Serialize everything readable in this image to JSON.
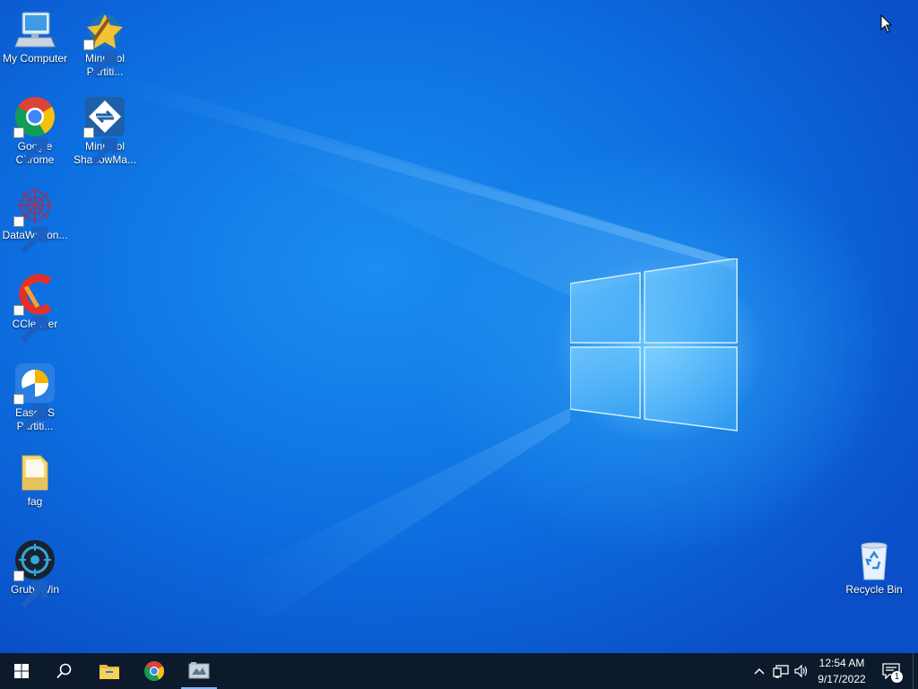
{
  "desktop": {
    "icons": [
      {
        "label_line1": "My Computer",
        "label_line2": "",
        "icon": "computer-icon"
      },
      {
        "label_line1": "MiniTool",
        "label_line2": "Partiti...",
        "icon": "minitool-partition-icon"
      },
      {
        "label_line1": "Google",
        "label_line2": "Chrome",
        "icon": "chrome-icon"
      },
      {
        "label_line1": "MiniTool",
        "label_line2": "ShadowMa...",
        "icon": "minitool-shadowmaker-icon"
      },
      {
        "label_line1": "DataWagon...",
        "label_line2": "",
        "icon": "datawagon-icon"
      },
      {
        "label_line1": "CCleaner",
        "label_line2": "",
        "icon": "ccleaner-icon"
      },
      {
        "label_line1": "EaseUS",
        "label_line2": "Partiti...",
        "icon": "easeus-icon"
      },
      {
        "label_line1": "fag",
        "label_line2": "",
        "icon": "folder-icon"
      },
      {
        "label_line1": "Grub2Win",
        "label_line2": "",
        "icon": "grub2win-icon"
      },
      {
        "label_line1": "Recycle Bin",
        "label_line2": "",
        "icon": "recycle-bin-icon"
      }
    ]
  },
  "taskbar": {
    "buttons": [
      "start-icon",
      "search-icon",
      "file-explorer-icon",
      "chrome-icon",
      "app-icon"
    ],
    "tray": {
      "icons": [
        "chevron-up-icon",
        "network-icon",
        "volume-icon"
      ],
      "time": "12:54 AM",
      "date": "9/17/2022",
      "notification_count": "1"
    }
  },
  "colors": {
    "accent": "#0a5fd6",
    "taskbar": "#0d1a2b",
    "active_indicator": "#7fb6ff"
  }
}
